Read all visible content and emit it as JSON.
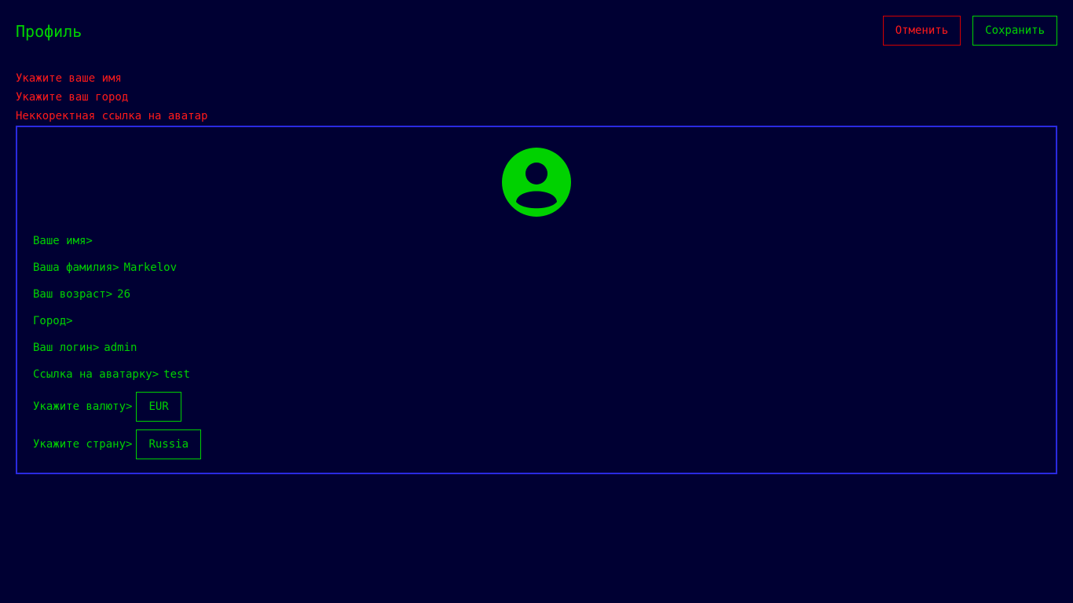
{
  "header": {
    "title": "Профиль",
    "cancel_label": "Отменить",
    "save_label": "Сохранить"
  },
  "errors": [
    "Укажите ваше имя",
    "Укажите ваш город",
    "Неккоректная ссылка на аватар"
  ],
  "profile": {
    "avatar_icon": "user-avatar-icon",
    "first_name": {
      "label": "Ваше имя>",
      "value": ""
    },
    "last_name": {
      "label": "Ваша фамилия>",
      "value": "Markelov"
    },
    "age": {
      "label": "Ваш возраст>",
      "value": "26"
    },
    "city": {
      "label": "Город>",
      "value": ""
    },
    "username": {
      "label": "Ваш логин>",
      "value": "admin"
    },
    "avatar_link": {
      "label": "Ссылка на аватарку>",
      "value": "test"
    },
    "currency": {
      "label": "Укажите валюту>",
      "value": "EUR"
    },
    "country": {
      "label": "Укажите страну>",
      "value": "Russia"
    }
  },
  "colors": {
    "background": "#000033",
    "accent_green": "#00d200",
    "error_red": "#ff1a1a",
    "card_border": "#2a2ae0"
  }
}
